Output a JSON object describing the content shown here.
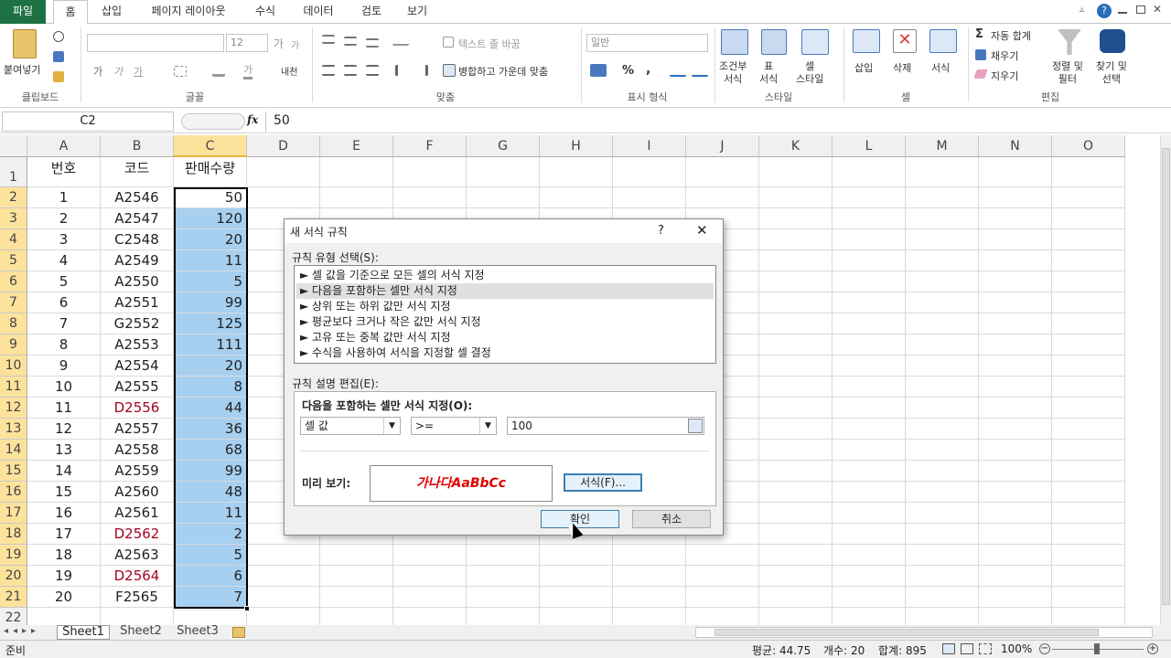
{
  "tabs": [
    "파일",
    "홈",
    "삽입",
    "페이지 레이아웃",
    "수식",
    "데이터",
    "검토",
    "보기"
  ],
  "ribbon": {
    "clipboard": {
      "paste": "붙여넣기",
      "label": "클립보드"
    },
    "font": {
      "size": "12",
      "label": "글꼴",
      "bold": "가",
      "italic": "가",
      "underline": "가",
      "grow": "가",
      "shrink": "가",
      "fontcolor": "가",
      "phonetic": "내천"
    },
    "align": {
      "wrap": "텍스트 줄 바꿈",
      "merge": "병합하고 가운데 맞춤",
      "label": "맞춤"
    },
    "number": {
      "format": "일반",
      "percent": "%",
      "comma": ",",
      "label": "표시 형식"
    },
    "styles": {
      "cond": "조건부\n서식",
      "table": "표\n서식",
      "cell": "셀\n스타일",
      "label": "스타일"
    },
    "cells": {
      "insert": "삽입",
      "delete": "삭제",
      "format": "서식",
      "label": "셀"
    },
    "editing": {
      "autosum": "자동 합계",
      "fill": "채우기",
      "clear": "지우기",
      "sort": "정렬 및\n필터",
      "find": "찾기 및\n선택",
      "label": "편집"
    }
  },
  "formula": {
    "namebox": "C2",
    "fx": "fx",
    "value": "50"
  },
  "columns": [
    "A",
    "B",
    "C",
    "D",
    "E",
    "F",
    "G",
    "H",
    "I",
    "J",
    "K",
    "L",
    "M",
    "N",
    "O"
  ],
  "headers": [
    "번호",
    "코드",
    "판매수량"
  ],
  "rows": [
    [
      "1",
      "A2546",
      "50"
    ],
    [
      "2",
      "A2547",
      "120"
    ],
    [
      "3",
      "C2548",
      "20"
    ],
    [
      "4",
      "A2549",
      "11"
    ],
    [
      "5",
      "A2550",
      "5"
    ],
    [
      "6",
      "A2551",
      "99"
    ],
    [
      "7",
      "G2552",
      "125"
    ],
    [
      "8",
      "A2553",
      "111"
    ],
    [
      "9",
      "A2554",
      "20"
    ],
    [
      "10",
      "A2555",
      "8"
    ],
    [
      "11",
      "D2556",
      "44"
    ],
    [
      "12",
      "A2557",
      "36"
    ],
    [
      "13",
      "A2558",
      "68"
    ],
    [
      "14",
      "A2559",
      "99"
    ],
    [
      "15",
      "A2560",
      "48"
    ],
    [
      "16",
      "A2561",
      "11"
    ],
    [
      "17",
      "D2562",
      "2"
    ],
    [
      "18",
      "A2563",
      "5"
    ],
    [
      "19",
      "D2564",
      "6"
    ],
    [
      "20",
      "F2565",
      "7"
    ]
  ],
  "row_numbers": [
    "1",
    "2",
    "3",
    "4",
    "5",
    "6",
    "7",
    "8",
    "9",
    "10",
    "11",
    "12",
    "13",
    "14",
    "15",
    "16",
    "17",
    "18",
    "19",
    "20",
    "21",
    "22"
  ],
  "dialog": {
    "title": "새 서식 규칙",
    "help": "?",
    "close": "✕",
    "select_label": "규칙 유형 선택(S):",
    "rule_types": [
      "► 셀 값을 기준으로 모든 셀의 서식 지정",
      "► 다음을 포함하는 셀만 서식 지정",
      "► 상위 또는 하위 값만 서식 지정",
      "► 평균보다 크거나 작은 값만 서식 지정",
      "► 고유 또는 중복 값만 서식 지정",
      "► 수식을 사용하여 서식을 지정할 셀 결정"
    ],
    "selected_index": 1,
    "edit_label": "규칙 설명 편집(E):",
    "edit_heading": "다음을 포함하는 셀만 서식 지정(O):",
    "cond_field": "셀 값",
    "cond_operator": ">=",
    "cond_value": "100",
    "preview_label": "미리 보기:",
    "preview_text": "가나다AaBbCc",
    "format_button": "서식(F)...",
    "ok": "확인",
    "cancel": "취소"
  },
  "sheets": [
    "Sheet1",
    "Sheet2",
    "Sheet3"
  ],
  "status": {
    "ready": "준비",
    "average": "평균: 44.75",
    "count": "개수: 20",
    "sum": "합계: 895",
    "zoom": "100%"
  },
  "colors": {
    "file_tab": "#1e7145",
    "selection": "#a6cff0",
    "red_code": "#a50021",
    "preview_text": "#e00000"
  }
}
